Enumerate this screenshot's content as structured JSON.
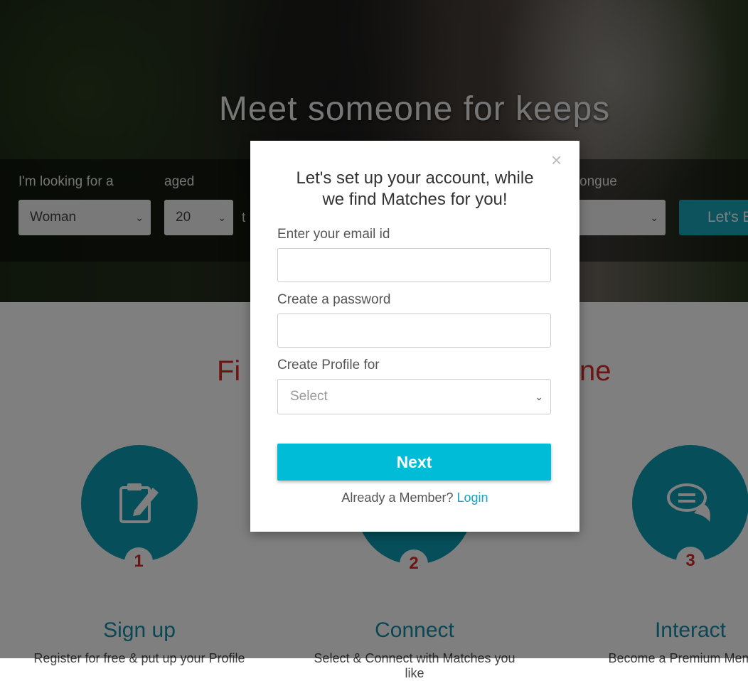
{
  "hero": {
    "title": "Meet someone for keeps"
  },
  "search": {
    "looking_for_label": "I'm looking for a",
    "looking_for_value": "Woman",
    "aged_label": "aged",
    "age_from_value": "20",
    "to_partial": "t",
    "tongue_label": "ongue",
    "cta_partial": "Let's B"
  },
  "section": {
    "title_left": "Fi",
    "title_right": "ne"
  },
  "steps": [
    {
      "number": "1",
      "title": "Sign up",
      "desc": "Register for free & put up your Profile"
    },
    {
      "number": "2",
      "title": "Connect",
      "desc": "Select & Connect with Matches you like"
    },
    {
      "number": "3",
      "title": "Interact",
      "desc": "Become a Premium Member"
    }
  ],
  "modal": {
    "title_line1": "Let's set up your account, while",
    "title_line2": "we find Matches for you!",
    "email_label": "Enter your email id",
    "password_label": "Create a password",
    "profile_label": "Create Profile for",
    "profile_placeholder": "Select",
    "next_label": "Next",
    "member_text": "Already a Member?",
    "login_label": "Login",
    "close_icon": "close-icon"
  },
  "colors": {
    "accent": "#00bcd6",
    "teal_circle": "#0b9db5",
    "title_red": "#d62a2a",
    "link": "#14a4c4"
  }
}
